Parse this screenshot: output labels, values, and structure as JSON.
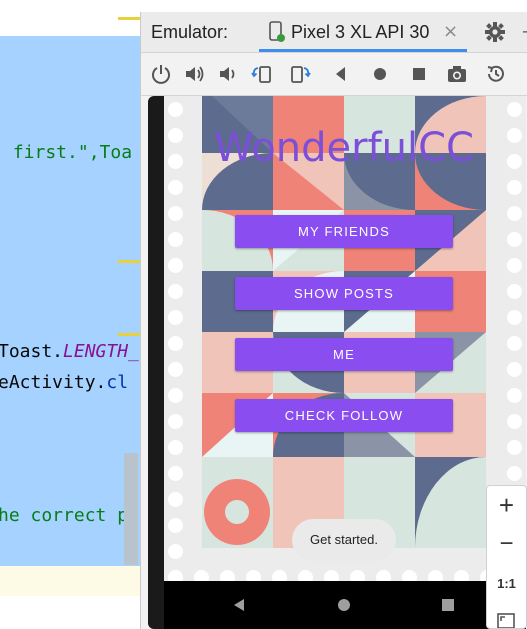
{
  "editor": {
    "lines": [
      {
        "text": " first.\",Toa",
        "style": "str"
      },
      {
        "text": "Toast.",
        "style": "dark",
        "extra": "LENGTH_",
        "extra_style": "italic"
      },
      {
        "text": "eActivity.",
        "style": "dark",
        "extra": "cl",
        "extra_style": "cls"
      },
      {
        "text": "he correct p",
        "style": "str"
      }
    ]
  },
  "emulator": {
    "label": "Emulator:",
    "device_tab": "Pixel 3 XL API 30",
    "close_glyph": "×",
    "toolbar_icons": [
      "power-icon",
      "volume-up-icon",
      "volume-down-icon",
      "rotate-left-icon",
      "rotate-right-icon",
      "back-icon",
      "home-icon",
      "overview-icon",
      "screenshot-icon",
      "snapshot-icon"
    ]
  },
  "app": {
    "title": "WonderfulCC",
    "buttons": [
      {
        "label": "MY FRIENDS"
      },
      {
        "label": "SHOW POSTS"
      },
      {
        "label": "ME"
      },
      {
        "label": "CHECK FOLLOW"
      }
    ],
    "toast": "Get started."
  },
  "zoom": {
    "plus": "+",
    "minus": "−",
    "ratio": "1:1"
  },
  "colors": {
    "accent": "#8a4ef0",
    "title": "#7c4fd8",
    "selection": "#a6d2ff"
  }
}
